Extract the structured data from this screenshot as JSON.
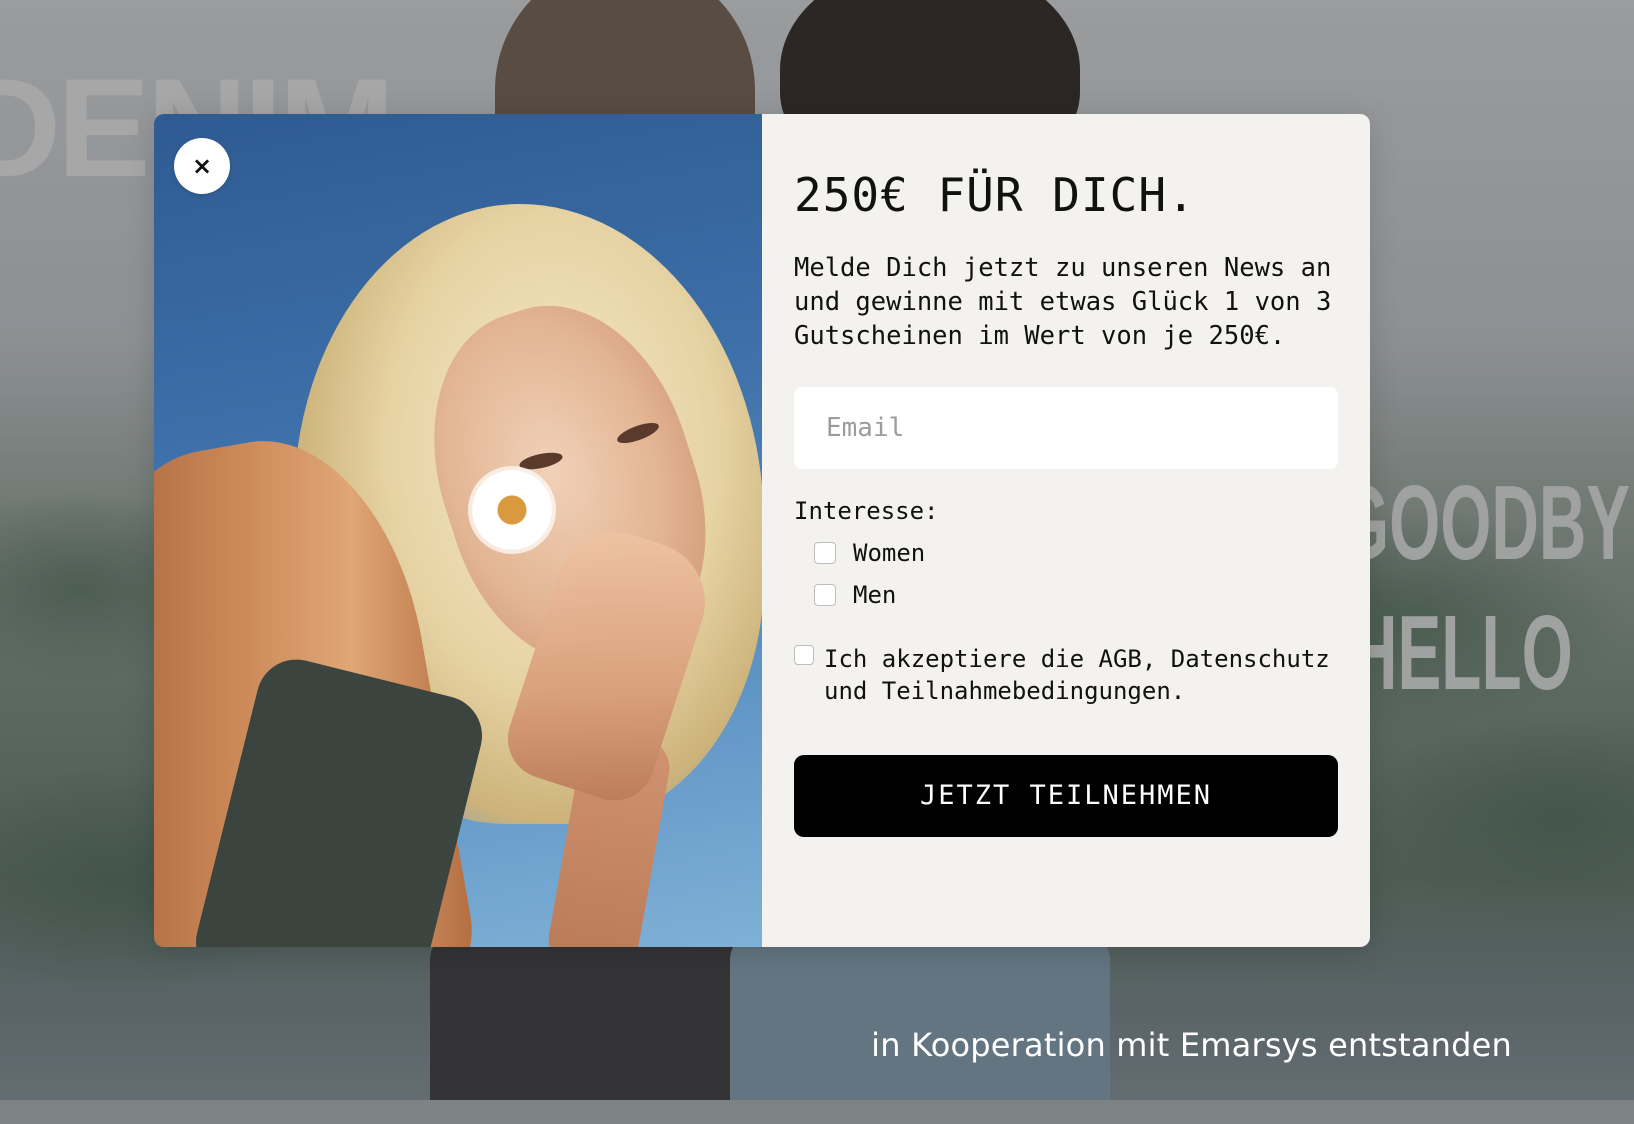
{
  "background": {
    "headline_left": "DENIM",
    "headline_right_1": "GOODBYE",
    "headline_right_2": "HELLO",
    "credit": "in Kooperation mit Emarsys entstanden"
  },
  "modal": {
    "close_icon": "×",
    "title": "250€ FÜR DICH.",
    "description": "Melde Dich jetzt zu unseren News an und gewinne mit etwas Glück 1 von 3 Gutscheinen im Wert von je 250€.",
    "email": {
      "value": "",
      "placeholder": "Email"
    },
    "interest_label": "Interesse:",
    "interests": [
      {
        "label": "Women",
        "checked": false
      },
      {
        "label": "Men",
        "checked": false
      }
    ],
    "terms_label": "Ich akzeptiere die AGB, Datenschutz und Teilnahmebedingungen.",
    "terms_checked": false,
    "submit_label": "JETZT TEILNEHMEN"
  },
  "colors": {
    "form_background": "#f3f2ee",
    "button_background": "#000000",
    "button_text": "#ffffff"
  }
}
